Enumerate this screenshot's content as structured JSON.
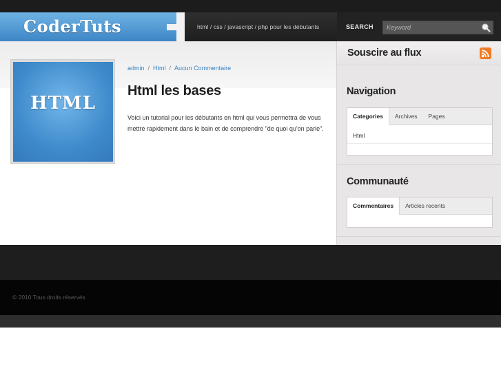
{
  "header": {
    "logo": "CoderTuts",
    "tagline": "html / css / javascript / php pour les débutants",
    "search_label": "SEARCH",
    "search_placeholder": "Keyword"
  },
  "post": {
    "thumbnail_text": "HTML",
    "meta": [
      "admin",
      "Html",
      "Aucun Commentaire"
    ],
    "meta_separator": "/",
    "title": "Html les bases",
    "body": "Voici un tutorial pour les débutants en html qui vous permettra de vous mettre rapidement dans le bain et de comprendre \"de quoi qu'on parle\"."
  },
  "sidebar": {
    "rss_title": "Souscire au flux",
    "navigation": {
      "title": "Navigation",
      "tabs": [
        "Categories",
        "Archives",
        "Pages"
      ],
      "active_tab": "Categories",
      "items": [
        "Html"
      ]
    },
    "community": {
      "title": "Communauté",
      "tabs": [
        "Commentaires",
        "Articles recents"
      ],
      "active_tab": "Commentaires"
    }
  },
  "footer": {
    "copyright": "© 2010 Tous droits réservés"
  },
  "colors": {
    "accent_blue": "#3a83c4",
    "logo_blue": "#4a93d0",
    "rss_orange": "#f07b24"
  },
  "icons": {
    "search": "magnifier-icon",
    "rss": "rss-feed-icon"
  }
}
